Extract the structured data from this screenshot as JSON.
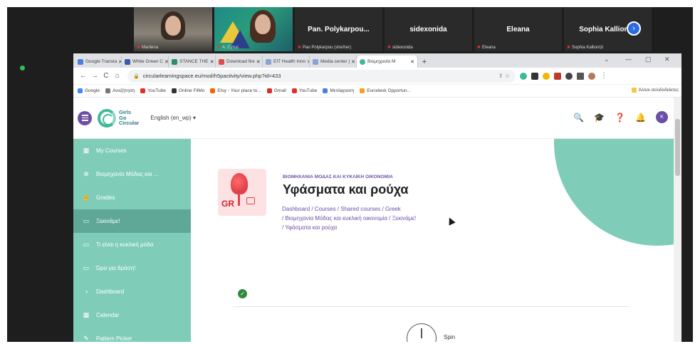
{
  "meeting": {
    "participants": [
      {
        "kind": "video",
        "label": "Marilena"
      },
      {
        "kind": "video",
        "label": "A. Cyrus"
      },
      {
        "kind": "name",
        "name": "Pan. Polykarpou...",
        "label": "Pan Polykarpou (she/her)"
      },
      {
        "kind": "name",
        "name": "sidexonida",
        "label": "sidexonida"
      },
      {
        "kind": "name",
        "name": "Eleana",
        "label": "Eleana"
      },
      {
        "kind": "name",
        "name": "Sophia Kalliontzi",
        "label": "Sophia Kalliontzi"
      }
    ],
    "more_label": "›"
  },
  "browser": {
    "tabs": [
      {
        "label": "Google Transla",
        "color": "#4a7fe0"
      },
      {
        "label": "White Green C",
        "color": "#3b5ba5"
      },
      {
        "label": "STANCE THE",
        "color": "#2d8c6a"
      },
      {
        "label": "Download fire",
        "color": "#e24b4b"
      },
      {
        "label": "EIT Health Inno",
        "color": "#8aa4d6"
      },
      {
        "label": "Media center |",
        "color": "#8aa4d6"
      },
      {
        "label": "Βιομηχανία Μ",
        "color": "#3fb99a",
        "active": true
      }
    ],
    "new_tab": "+",
    "window_controls": [
      "⌄",
      "—",
      "▢",
      "✕"
    ],
    "nav": {
      "back": "←",
      "forward": "→",
      "reload": "C",
      "home": "⌂"
    },
    "url": "circularlearningspace.eu/mod/h5pactivity/view.php?id=433",
    "omnibox_icons": "⇪ ☆",
    "bookmarks": [
      {
        "label": "Google",
        "color": "#4285f4"
      },
      {
        "label": "Αναζήτηση",
        "color": "#777"
      },
      {
        "label": "YouTube",
        "color": "#e52d27"
      },
      {
        "label": "Online FilMo",
        "color": "#333"
      },
      {
        "label": "Etsy - Your place to...",
        "color": "#f56400"
      },
      {
        "label": "Gmail",
        "color": "#d93025"
      },
      {
        "label": "YouTube",
        "color": "#e52d27"
      },
      {
        "label": "Μετάφραση",
        "color": "#4a7fe0"
      },
      {
        "label": "Eurodesk Opportun...",
        "color": "#f0a21c"
      }
    ],
    "bookmarks_other": "Άλλοι σελιδοδείκτες"
  },
  "site": {
    "logo_lines": [
      "Girls",
      "Go",
      "Circular"
    ],
    "language": "English (en_wp) ▾",
    "header_icons": [
      "🔍",
      "🎓",
      "❓",
      "🔔"
    ],
    "avatar_initial": "K",
    "sidebar": [
      {
        "label": "My Courses",
        "icon": "▦"
      },
      {
        "label": "Βιομηχανία Μόδας και ...",
        "icon": "⊕"
      },
      {
        "label": "Grades",
        "icon": "☝"
      },
      {
        "label": "Ξεκινάμε!",
        "icon": "▭",
        "active": true
      },
      {
        "label": "Τι είναι η κυκλική μόδα",
        "icon": "▭"
      },
      {
        "label": "Ώρα για δράση!",
        "icon": "▭"
      },
      {
        "label": "Dashboard",
        "icon": "◔"
      },
      {
        "label": "Calendar",
        "icon": "▦"
      },
      {
        "label": "Pattern Picker",
        "icon": "✎"
      }
    ],
    "course": {
      "badge": "GR",
      "category": "ΒΙΟΜΗΧΑΝΙΑ ΜΟΔΑΣ ΚΑΙ ΚΥΚΛΙΚΗ ΟΙΚΟΝΟΜΙΑ",
      "title": "Υφάσματα και ρούχα",
      "breadcrumb_line1": "Dashboard / Courses / Shared courses / Greek",
      "breadcrumb_line2": "/ Βιομηχανία Μόδας και κυκλική οικονομία / Ξεκινάμε!",
      "breadcrumb_line3": "/ Υφάσματα και ρούχα"
    },
    "completion_check": "✓",
    "activity_label": "Spin"
  }
}
